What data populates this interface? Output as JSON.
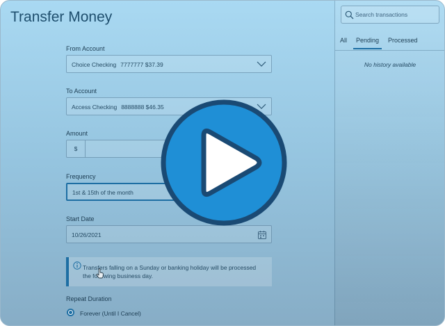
{
  "page": {
    "title": "Transfer Money"
  },
  "form": {
    "from_label": "From Account",
    "from_account": {
      "name": "Choice Checking",
      "number": "7777777",
      "balance": "$37.39"
    },
    "to_label": "To Account",
    "to_account": {
      "name": "Access Checking",
      "number": "8888888",
      "balance": "$46.35"
    },
    "amount_label": "Amount",
    "currency_symbol": "$",
    "amount_value": "",
    "frequency_label": "Frequency",
    "frequency_value": "1st & 15th of the month",
    "start_date_label": "Start Date",
    "start_date_value": "10/26/2021",
    "info_text": "Transfers falling on a Sunday or banking holiday will be processed the following business day.",
    "repeat_label": "Repeat Duration",
    "repeat_option": "Forever (Until I Cancel)"
  },
  "history": {
    "search_placeholder": "Search transactions",
    "tabs": [
      {
        "label": "All"
      },
      {
        "label": "Pending"
      },
      {
        "label": "Processed"
      }
    ],
    "active_tab": "Pending",
    "empty_text": "No history available"
  },
  "overlay": {
    "icon": "play-icon"
  },
  "colors": {
    "accent": "#1d6ea3",
    "play_fill": "#1f8fd6",
    "play_ring": "#1a4a74",
    "text": "#1c3c52"
  }
}
